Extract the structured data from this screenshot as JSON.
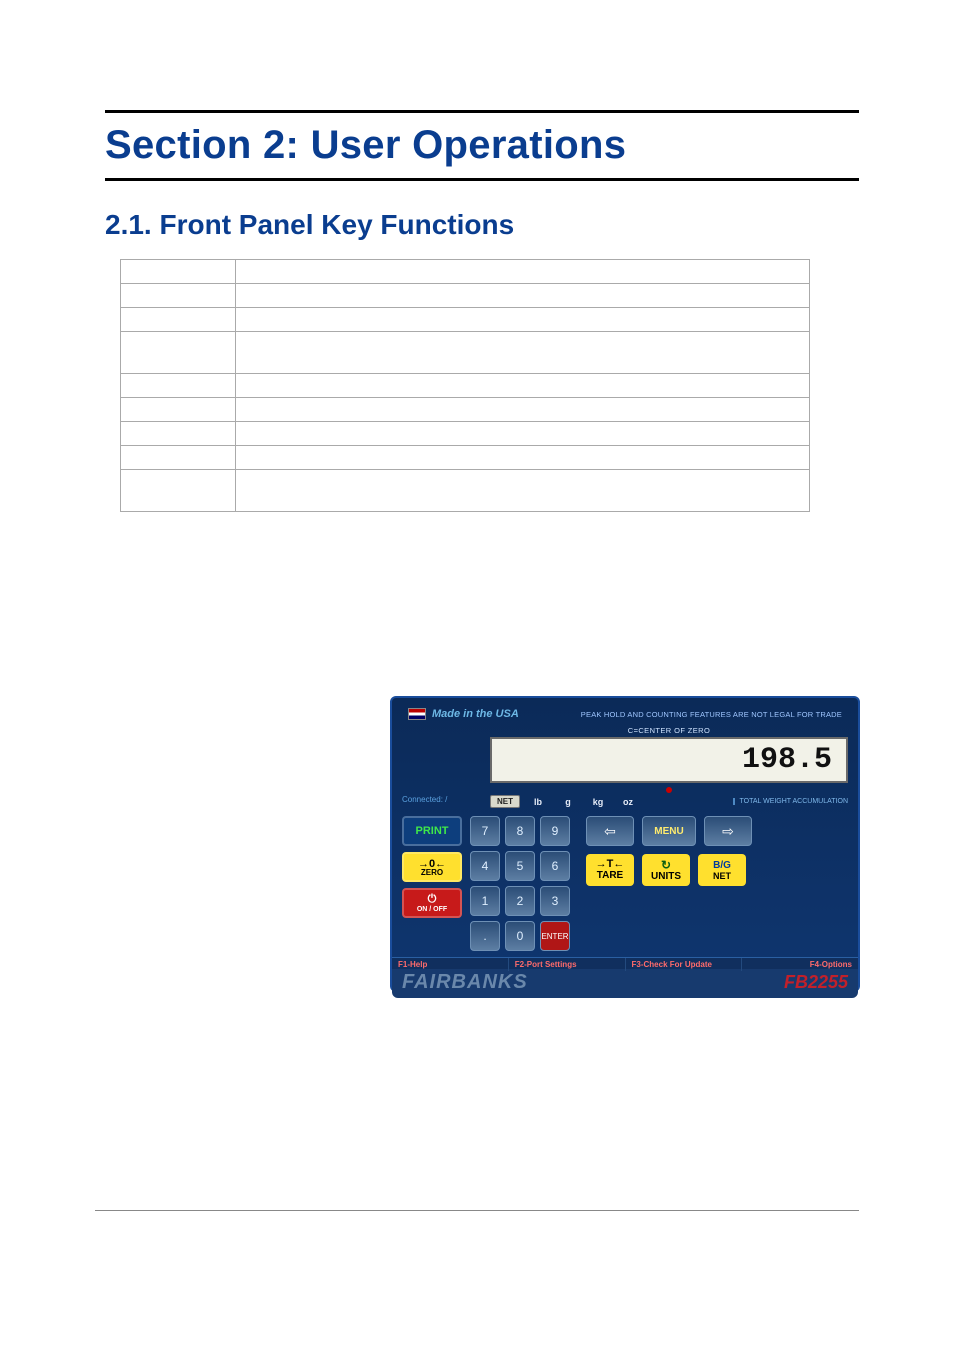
{
  "section_title": "Section 2:  User Operations",
  "subheading": "2.1.   Front Panel Key Functions",
  "device": {
    "made_in": "Made in the USA",
    "top_warning": "PEAK HOLD AND COUNTING FEATURES ARE NOT LEGAL FOR TRADE",
    "center_zero_label": "C=CENTER OF ZERO",
    "connected_label": "Connected: /",
    "weight_value": "198.5",
    "annunciators": {
      "net": "NET",
      "units": [
        "lb",
        "g",
        "kg",
        "oz"
      ]
    },
    "accumulator_label": "TOTAL WEIGHT\nACCUMULATION",
    "buttons": {
      "print": "PRINT",
      "zero_symbol": "→0←",
      "zero_label": "ZERO",
      "onoff_label": "ON / OFF",
      "menu": "MENU",
      "tare_symbol": "→T←",
      "tare_label": "TARE",
      "units_label": "UNITS",
      "bg": "B/G",
      "net": "NET",
      "enter": "ENTER"
    },
    "numpad": [
      "7",
      "8",
      "9",
      "4",
      "5",
      "6",
      "1",
      "2",
      "3",
      ".",
      "0"
    ],
    "fkeys": {
      "f1": "F1-Help",
      "f2": "F2-Port Settings",
      "f3": "F3-Check For Update",
      "f4": "F4-Options"
    },
    "brand": "FAIRBANKS",
    "model": "FB2255"
  }
}
